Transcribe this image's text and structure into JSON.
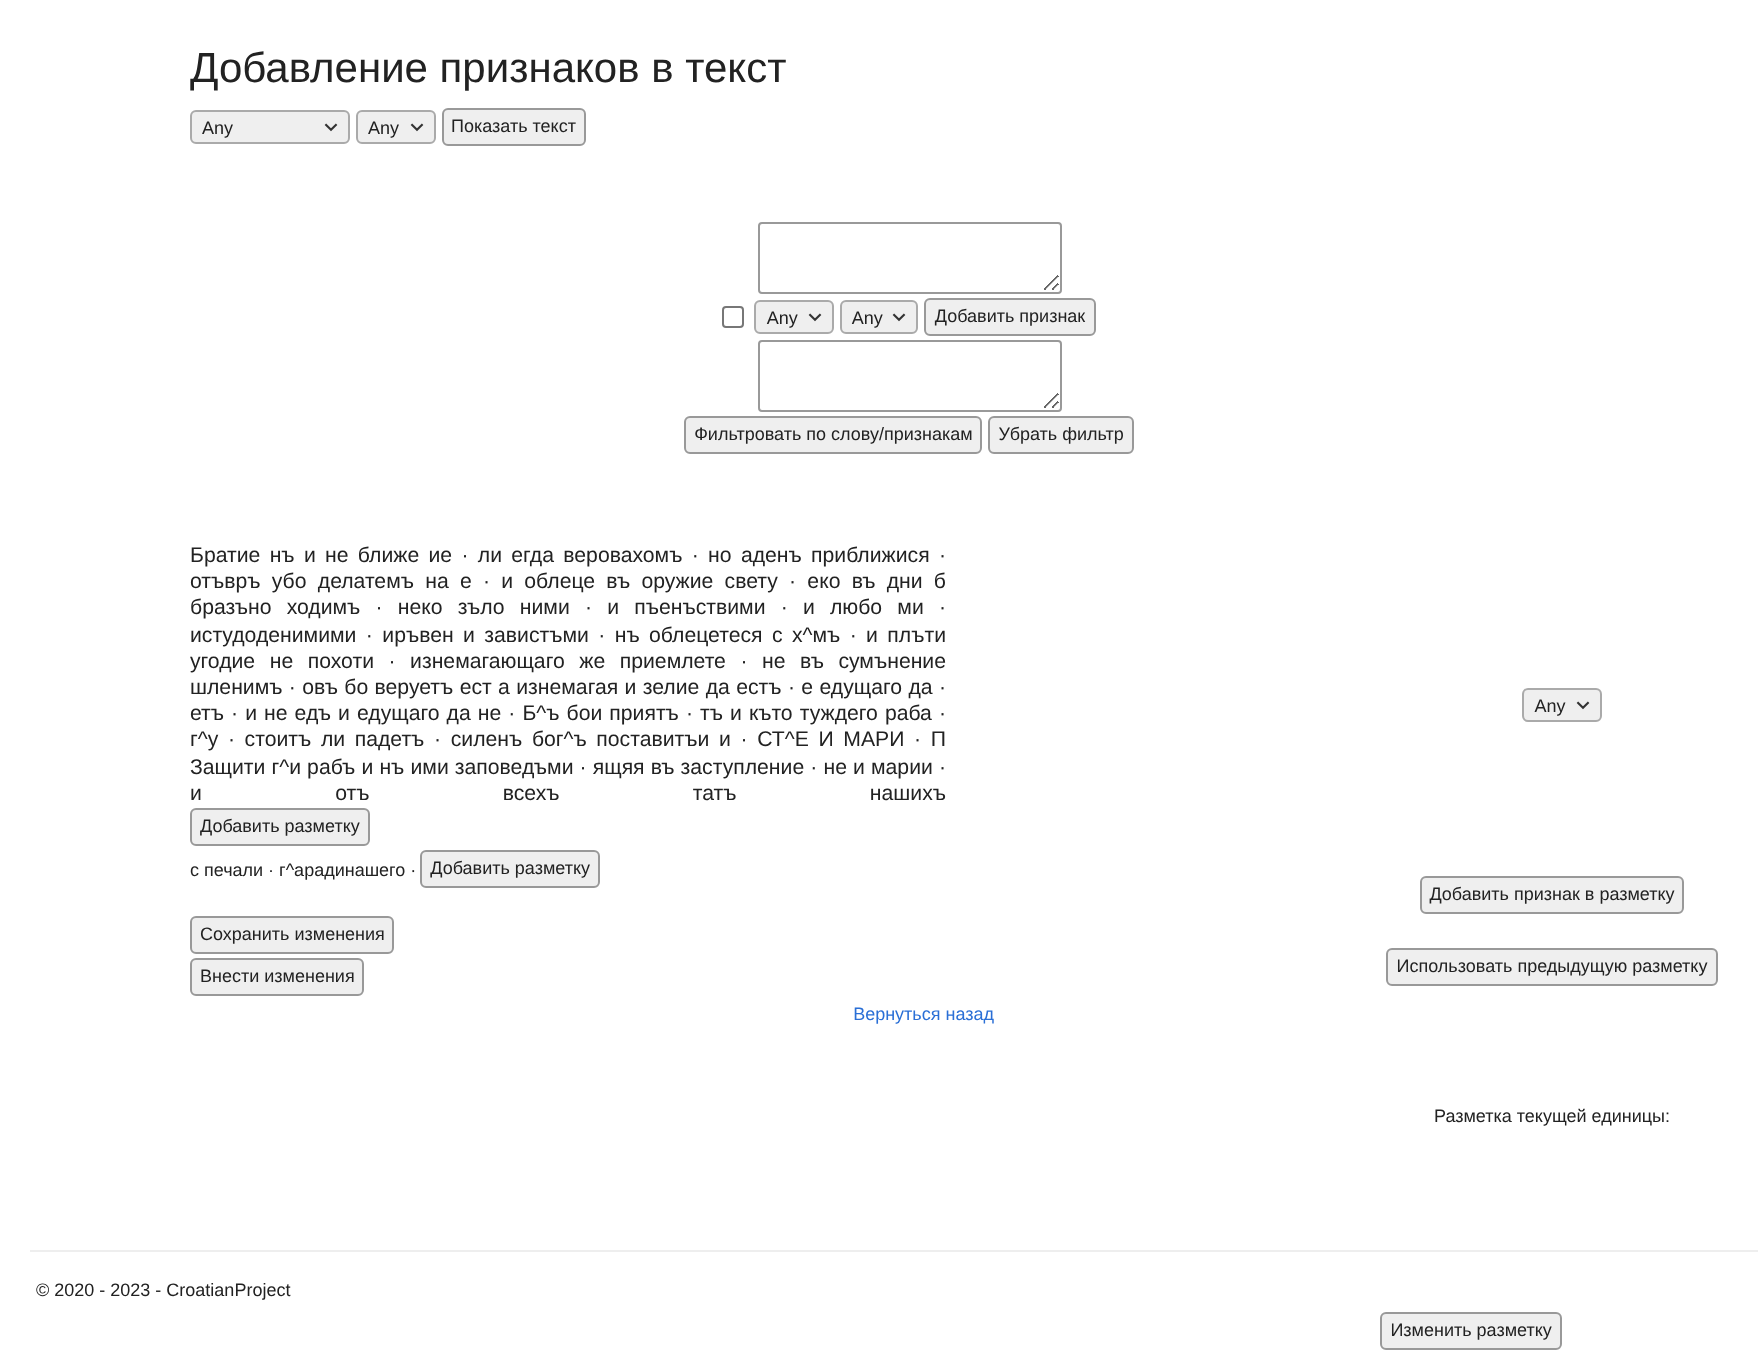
{
  "title": "Добавление признаков в текст",
  "top_controls": {
    "selects": [
      {
        "value": "Any",
        "wide": true
      },
      {
        "value": "Any",
        "wide": false
      }
    ],
    "button": "Показать текст"
  },
  "filter": {
    "checkbox_checked": false,
    "selects": [
      {
        "value": "Any"
      },
      {
        "value": "Any"
      }
    ],
    "add_button": "Добавить признак",
    "filter_button": "Фильтровать по слову/признакам",
    "clear_button": "Убрать фильтр"
  },
  "text": "Братие нъ и не ближе ие · ли егда веровахомъ · но аденъ приближися · отъвръ убо делатемъ на е · и облеце въ оружие свету · еко въ дни б бразъно ходимъ · неко зъло ними · и пъенъствими · и любо ми · истудоденимими · иръвен и завистъми · нъ облецетеся с х^мъ · и плъти угодие не похоти · изнемагающаго же приемлете · не въ сумънение шленимъ · овъ бо веруетъ ест а изнемагая и зелие да естъ · е едущаго да · етъ · и не едъ и едущаго да не · Б^ъ бои приятъ · тъ и къто туждего раба · г^у · стоитъ ли падетъ · силенъ бог^ъ поставитъи и · СТ^Е И МАРИ · П Защити г^и рабъ и нъ ими заповедъми · ящяя въ заступление · не и марии · и отъ всехъ татъ нашихъ",
  "markup_button_1": "Добавить разметку",
  "second_text": "с печали · г^арадинашего ·",
  "markup_button_2": "Добавить разметку",
  "save_button": "Сохранить изменения",
  "apply_button": "Внести изменения",
  "back_link": "Вернуться назад",
  "side": {
    "select": {
      "value": "Any"
    },
    "add_feature_button": "Добавить признак в разметку",
    "use_previous_button": "Использовать предыдущую разметку",
    "current_label": "Разметка текущей единицы:"
  },
  "footer": {
    "copyright": "© 2020 - 2023 - CroatianProject",
    "edit_button": "Изменить разметку"
  }
}
